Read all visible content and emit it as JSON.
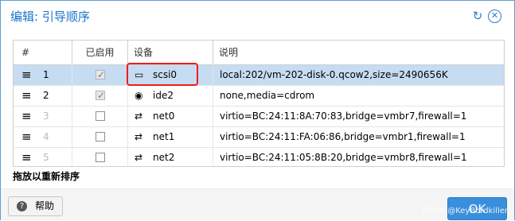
{
  "window": {
    "title": "编辑: 引导顺序"
  },
  "toolbar": {
    "refresh_icon": "refresh-icon",
    "close_icon": "close-icon"
  },
  "table": {
    "columns": [
      "#",
      "已启用",
      "设备",
      "说明"
    ],
    "rows": [
      {
        "index": "1",
        "enabled": true,
        "device": "scsi0",
        "device_icon": "disk-icon",
        "description": "local:202/vm-202-disk-0.qcow2,size=2490656K",
        "selected": true,
        "dim": false
      },
      {
        "index": "2",
        "enabled": true,
        "device": "ide2",
        "device_icon": "cdrom-icon",
        "description": "none,media=cdrom",
        "selected": false,
        "dim": false
      },
      {
        "index": "3",
        "enabled": false,
        "device": "net0",
        "device_icon": "network-icon",
        "description": "virtio=BC:24:11:8A:70:83,bridge=vmbr7,firewall=1",
        "selected": false,
        "dim": true
      },
      {
        "index": "4",
        "enabled": false,
        "device": "net1",
        "device_icon": "network-icon",
        "description": "virtio=BC:24:11:FA:06:86,bridge=vmbr1,firewall=1",
        "selected": false,
        "dim": true
      },
      {
        "index": "5",
        "enabled": false,
        "device": "net2",
        "device_icon": "network-icon",
        "description": "virtio=BC:24:11:05:8B:20,bridge=vmbr8,firewall=1",
        "selected": false,
        "dim": true
      }
    ]
  },
  "hint": "拖放以重新排序",
  "footer": {
    "help_label": "帮助",
    "ok_label": "OK"
  },
  "watermark": "CSDN @KeyBordkiller",
  "colors": {
    "accent": "#3a8fdc",
    "selected_row": "#c6dcf2",
    "highlight": "#ee1d1d"
  }
}
